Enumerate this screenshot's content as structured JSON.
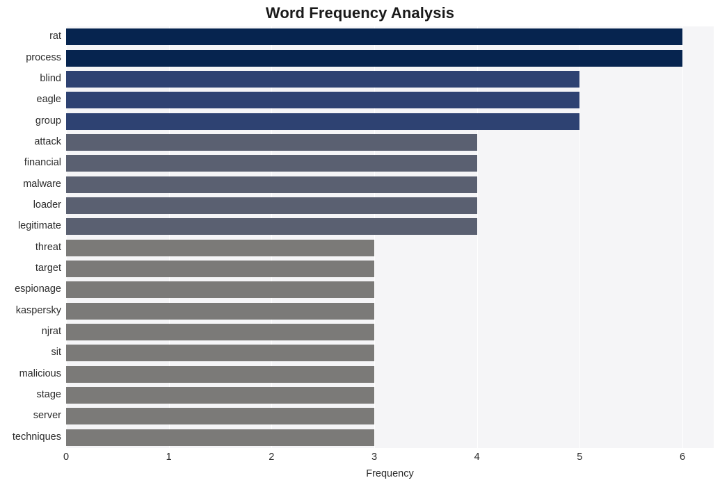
{
  "chart_data": {
    "type": "bar",
    "orientation": "horizontal",
    "title": "Word Frequency Analysis",
    "xlabel": "Frequency",
    "ylabel": "",
    "xlim": [
      0,
      6
    ],
    "xticks": [
      0,
      1,
      2,
      3,
      4,
      5,
      6
    ],
    "xtick_labels": [
      "0",
      "1",
      "2",
      "3",
      "4",
      "5",
      "6"
    ],
    "grid": true,
    "grid_axis": "x",
    "legend": "none",
    "categories": [
      "rat",
      "process",
      "blind",
      "eagle",
      "group",
      "attack",
      "financial",
      "malware",
      "loader",
      "legitimate",
      "threat",
      "target",
      "espionage",
      "kaspersky",
      "njrat",
      "sit",
      "malicious",
      "stage",
      "server",
      "techniques"
    ],
    "values": [
      6,
      6,
      5,
      5,
      5,
      4,
      4,
      4,
      4,
      4,
      3,
      3,
      3,
      3,
      3,
      3,
      3,
      3,
      3,
      3
    ],
    "bar_colors": [
      "#06244f",
      "#06244f",
      "#2e4272",
      "#2e4272",
      "#2e4272",
      "#5a6071",
      "#5a6071",
      "#5a6071",
      "#5a6071",
      "#5a6071",
      "#7b7a78",
      "#7b7a78",
      "#7b7a78",
      "#7b7a78",
      "#7b7a78",
      "#7b7a78",
      "#7b7a78",
      "#7b7a78",
      "#7b7a78",
      "#7b7a78"
    ],
    "plot_background": "#f5f5f7",
    "grid_color": "#ffffff",
    "figure_background": "#ffffff"
  }
}
